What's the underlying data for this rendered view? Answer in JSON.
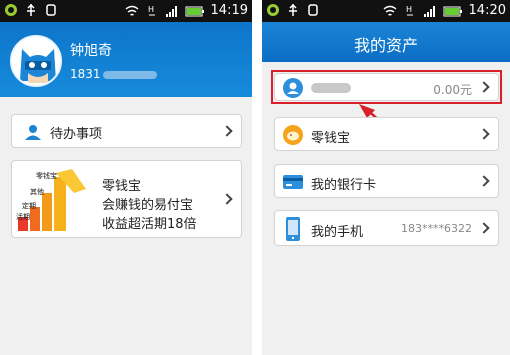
{
  "status_left": {
    "time": "14:19"
  },
  "status_right": {
    "time": "14:20"
  },
  "profile": {
    "name": "钟旭奇",
    "phone_prefix": "1831"
  },
  "todo": {
    "label": "待办事项"
  },
  "promo": {
    "title": "零钱宝",
    "line2": "会赚钱的易付宝",
    "line3": "收益超活期18倍",
    "chart_labels": [
      "零钱宝",
      "其他",
      "定期",
      "活期"
    ]
  },
  "assets": {
    "title": "我的资产",
    "account": {
      "amount": "0.00元"
    },
    "items": [
      {
        "label": "零钱宝",
        "value": ""
      },
      {
        "label": "我的银行卡",
        "value": ""
      },
      {
        "label": "我的手机",
        "value": "183****6322"
      }
    ]
  },
  "colors": {
    "header_blue": "#1580d4",
    "highlight_red": "#d8202a",
    "coin_orange": "#f5a21c"
  }
}
